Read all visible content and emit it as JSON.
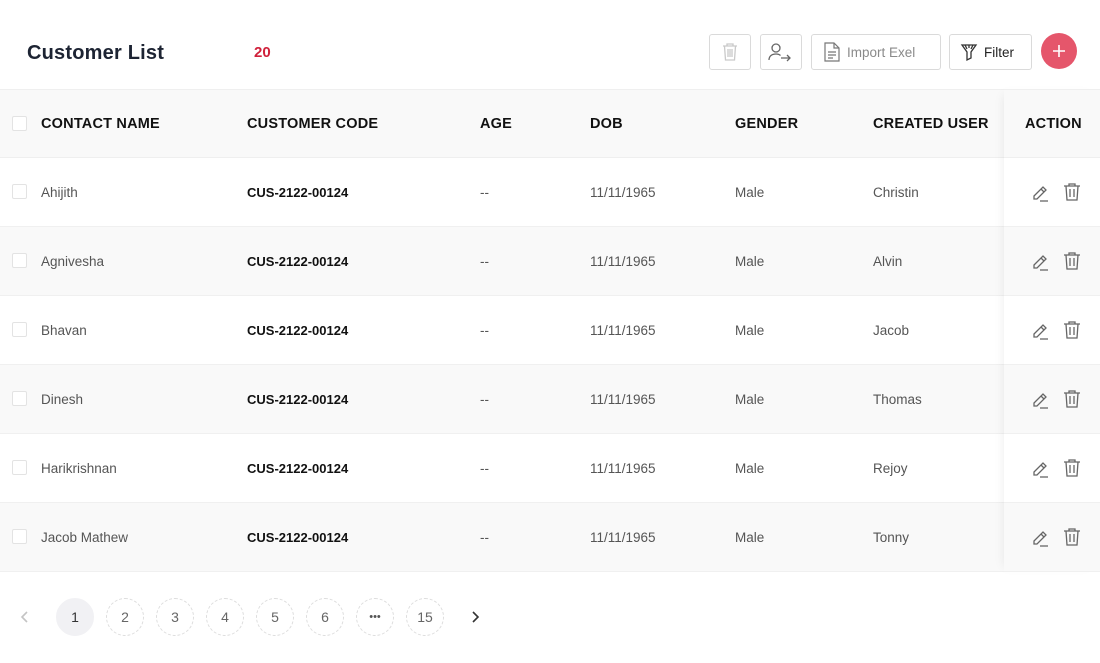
{
  "header": {
    "title": "Customer List",
    "count": "20",
    "import_label": "Import Exel",
    "filter_label": "Filter"
  },
  "colors": {
    "accent": "#e5566b",
    "count": "#d0213b"
  },
  "icons": {
    "delete": "trash-icon",
    "assign": "user-assign-icon",
    "import": "document-icon",
    "filter": "funnel-icon",
    "add": "plus-icon",
    "edit": "pencil-icon"
  },
  "table": {
    "columns": [
      "CONTACT NAME",
      "CUSTOMER CODE",
      "AGE",
      "DOB",
      "GENDER",
      "CREATED USER",
      "ACTION"
    ],
    "rows": [
      {
        "name": "Ahijith",
        "code": "CUS-2122-00124",
        "age": "--",
        "dob": "11/11/1965",
        "gender": "Male",
        "user": "Christin"
      },
      {
        "name": "Agnivesha",
        "code": "CUS-2122-00124",
        "age": "--",
        "dob": "11/11/1965",
        "gender": "Male",
        "user": "Alvin"
      },
      {
        "name": "Bhavan",
        "code": "CUS-2122-00124",
        "age": "--",
        "dob": "11/11/1965",
        "gender": "Male",
        "user": "Jacob"
      },
      {
        "name": "Dinesh",
        "code": "CUS-2122-00124",
        "age": "--",
        "dob": "11/11/1965",
        "gender": "Male",
        "user": "Thomas"
      },
      {
        "name": "Harikrishnan",
        "code": "CUS-2122-00124",
        "age": "--",
        "dob": "11/11/1965",
        "gender": "Male",
        "user": "Rejoy"
      },
      {
        "name": "Jacob Mathew",
        "code": "CUS-2122-00124",
        "age": "--",
        "dob": "11/11/1965",
        "gender": "Male",
        "user": "Tonny"
      }
    ]
  },
  "pagination": {
    "pages": [
      "1",
      "2",
      "3",
      "4",
      "5",
      "6",
      "•••",
      "15"
    ],
    "current": "1"
  }
}
